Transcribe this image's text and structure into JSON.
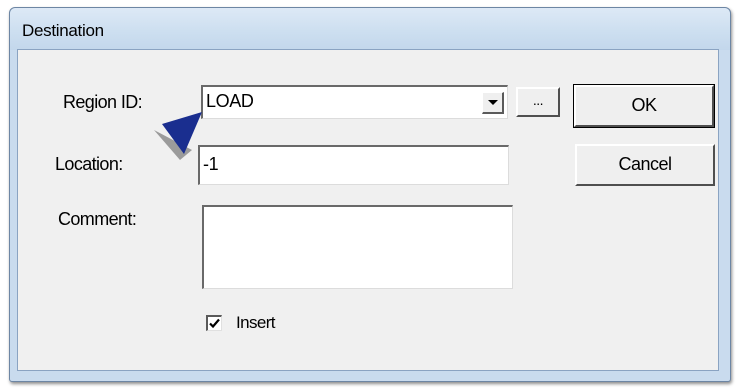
{
  "dialog": {
    "title": "Destination"
  },
  "fields": {
    "region_id_label": "Region ID:",
    "region_id_value": "LOAD",
    "browse_label": "...",
    "location_label": "Location:",
    "location_value": "-1",
    "comment_label": "Comment:",
    "comment_value": "",
    "insert_label": "Insert",
    "insert_checked": true
  },
  "buttons": {
    "ok_label": "OK",
    "cancel_label": "Cancel"
  },
  "icons": {
    "dropdown": "chevron-down-icon",
    "checkbox": "checkmark-icon",
    "pointer": "arrow-pointer-icon"
  },
  "colors": {
    "frame": "#c9dbee",
    "client": "#f0f0f0",
    "pointer": "#1a2e8f"
  }
}
